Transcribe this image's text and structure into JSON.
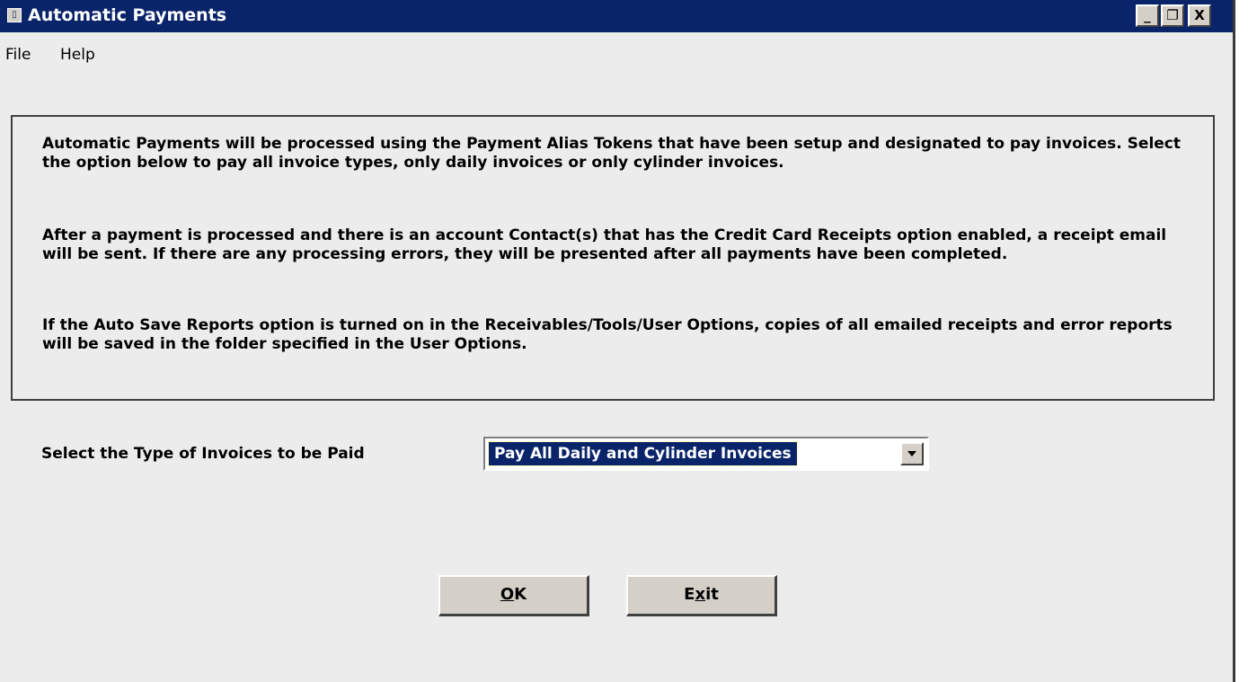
{
  "window": {
    "title": "Automatic Payments",
    "icon": "app-icon",
    "controls": {
      "minimize": "_",
      "restore": "š",
      "close": "X"
    }
  },
  "menu": {
    "items": [
      "File",
      "Help"
    ]
  },
  "info": {
    "paragraphs": [
      "Automatic Payments will be processed using the Payment Alias Tokens that have been setup and designated to pay invoices.  Select the option below to pay all invoice types, only daily invoices or only cylinder invoices.",
      "After a payment is processed and there is an account Contact(s) that has the Credit Card Receipts option enabled, a receipt email will be sent.   If there are any processing errors, they will be presented after all payments have been completed.",
      "If the Auto Save Reports option is turned on in the Receivables/Tools/User Options, copies of all emailed receipts and error reports will be saved in the folder specified in the User Options."
    ]
  },
  "invoice_type": {
    "label": "Select the Type of Invoices to be Paid",
    "selected": "Pay All Daily and Cylinder Invoices"
  },
  "buttons": {
    "ok": {
      "mnemonic": "O",
      "rest": "K"
    },
    "exit": {
      "pre": "E",
      "mnemonic": "x",
      "rest": "it"
    }
  },
  "colors": {
    "titlebar": "#0a246a",
    "window_bg": "#ececec",
    "button_face": "#d4d0c8",
    "selection": "#0a246a"
  }
}
